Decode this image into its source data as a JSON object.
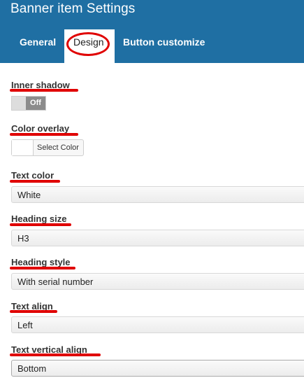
{
  "header": {
    "title": "Banner item Settings",
    "tabs": {
      "general": "General",
      "design": "Design",
      "button": "Button customize"
    }
  },
  "fields": {
    "inner_shadow": {
      "label": "Inner shadow",
      "toggle_state": "Off"
    },
    "color_overlay": {
      "label": "Color overlay",
      "button_label": "Select Color"
    },
    "text_color": {
      "label": "Text color",
      "value": "White"
    },
    "heading_size": {
      "label": "Heading size",
      "value": "H3"
    },
    "heading_style": {
      "label": "Heading style",
      "value": "With serial number"
    },
    "text_align": {
      "label": "Text align",
      "value": "Left"
    },
    "text_vertical_align": {
      "label": "Text vertical align",
      "value": "Bottom"
    }
  },
  "colors": {
    "header_bg": "#1f6fa3",
    "annotation": "#e00000"
  }
}
